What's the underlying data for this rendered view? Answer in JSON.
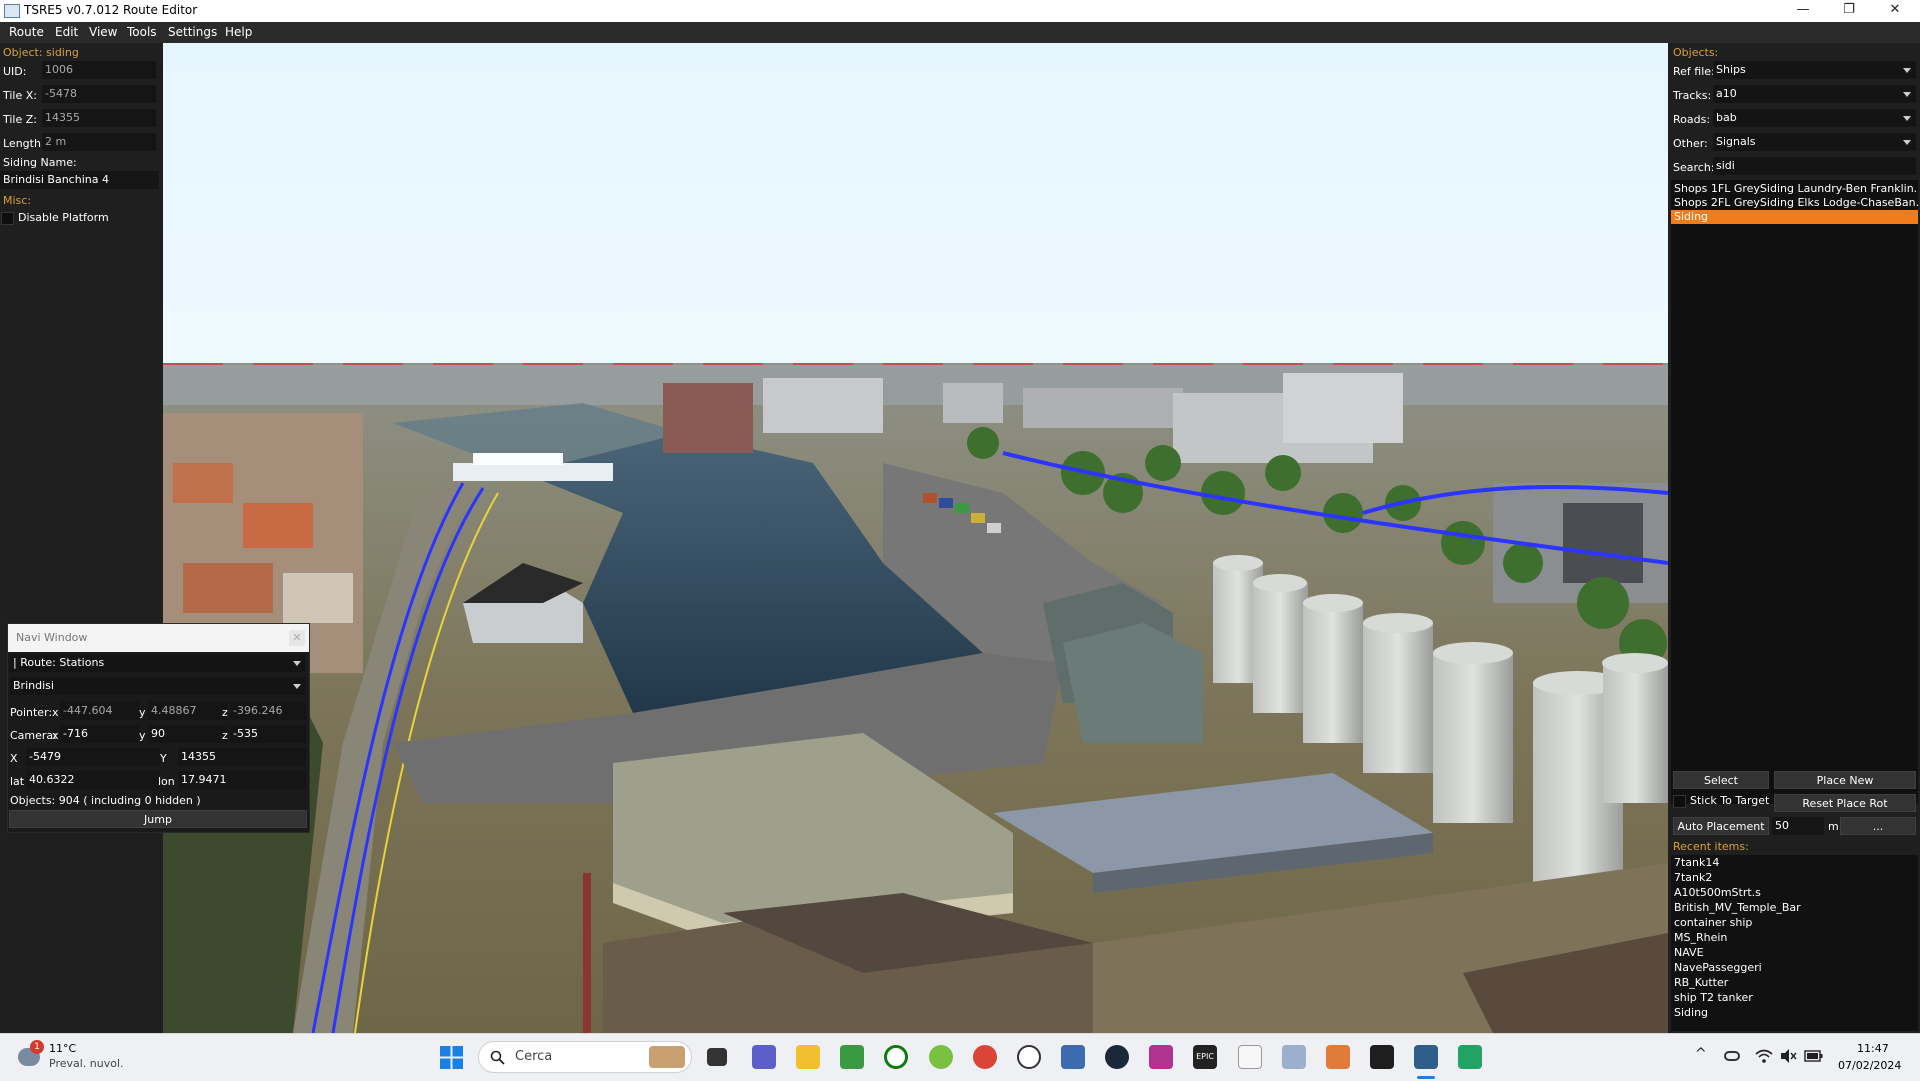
{
  "window": {
    "title": "TSRE5 v0.7.012 Route Editor",
    "min_glyph": "—",
    "max_glyph": "❐",
    "close_glyph": "✕"
  },
  "menu": [
    "Route",
    "Edit",
    "View",
    "Tools",
    "Settings",
    "Help"
  ],
  "left_panel": {
    "object_header": "Object: siding",
    "uid_label": "UID:",
    "uid_value": "1006",
    "tilex_label": "Tile X:",
    "tilex_value": "-5478",
    "tilez_label": "Tile Z:",
    "tilez_value": "14355",
    "length_label": "Length:",
    "length_value": "2 m",
    "siding_name_label": "Siding Name:",
    "siding_name_value": "Brindisi Banchina 4",
    "misc_header": "Misc:",
    "disable_platform_label": "Disable Platform"
  },
  "navi": {
    "title": "Navi Window",
    "close_glyph": "✕",
    "route_select": "| Route: Stations",
    "station_select": "Brindisi",
    "pointer_label": "Pointer:",
    "pointer_x": "-447.604",
    "pointer_y": "4.48867",
    "pointer_z": "-396.246",
    "camera_label": "Camera:",
    "camera_x": "-716",
    "camera_y": "90",
    "camera_z": "-535",
    "x_label": "X",
    "x_value": "-5479",
    "y_label": "Y",
    "y_value": "14355",
    "lat_label": "lat",
    "lat_value": "40.6322",
    "lon_label": "lon",
    "lon_value": "17.9471",
    "objects_text": "Objects: 904 ( including 0 hidden )",
    "jump_label": "Jump",
    "axis_x": "x",
    "axis_y": "y",
    "axis_z": "z"
  },
  "right_panel": {
    "objects_header": "Objects:",
    "ref_file_label": "Ref file:",
    "ref_file_value": "Ships",
    "tracks_label": "Tracks:",
    "tracks_value": "a10",
    "roads_label": "Roads:",
    "roads_value": "bab",
    "other_label": "Other:",
    "other_value": "Signals",
    "search_label": "Search:",
    "search_value": "sidi",
    "results": [
      "Shops 1FL GreySiding Laundry-Ben Franklin...",
      "Shops 2FL GreySiding Elks Lodge-ChaseBan...",
      "Siding"
    ],
    "select_label": "Select",
    "place_new_label": "Place New",
    "stick_to_target_label": "Stick To Target",
    "reset_place_rot_label": "Reset Place Rot",
    "auto_placement_label": "Auto Placement",
    "auto_placement_value": "50",
    "auto_placement_unit": "m",
    "more_label": "...",
    "recent_header": "Recent items:",
    "recent": [
      "7tank14",
      "7tank2",
      "A10t500mStrt.s",
      "British_MV_Temple_Bar",
      "container ship",
      "MS_Rhein",
      "NAVE",
      "NavePasseggeri",
      "RB_Kutter",
      "ship T2 tanker",
      "Siding"
    ]
  },
  "taskbar": {
    "weather_badge": "1",
    "weather_temp": "11°C",
    "weather_desc": "Preval. nuvol.",
    "search_placeholder": "Cerca",
    "time": "11:47",
    "date": "07/02/2024",
    "epic_label": "EPIC",
    "tray_chevron": "^"
  },
  "colors": {
    "accent_orange": "#f07d1a",
    "section_gold": "#d8a23a",
    "sky": "#e6f6ff",
    "water": "#2b4457"
  }
}
